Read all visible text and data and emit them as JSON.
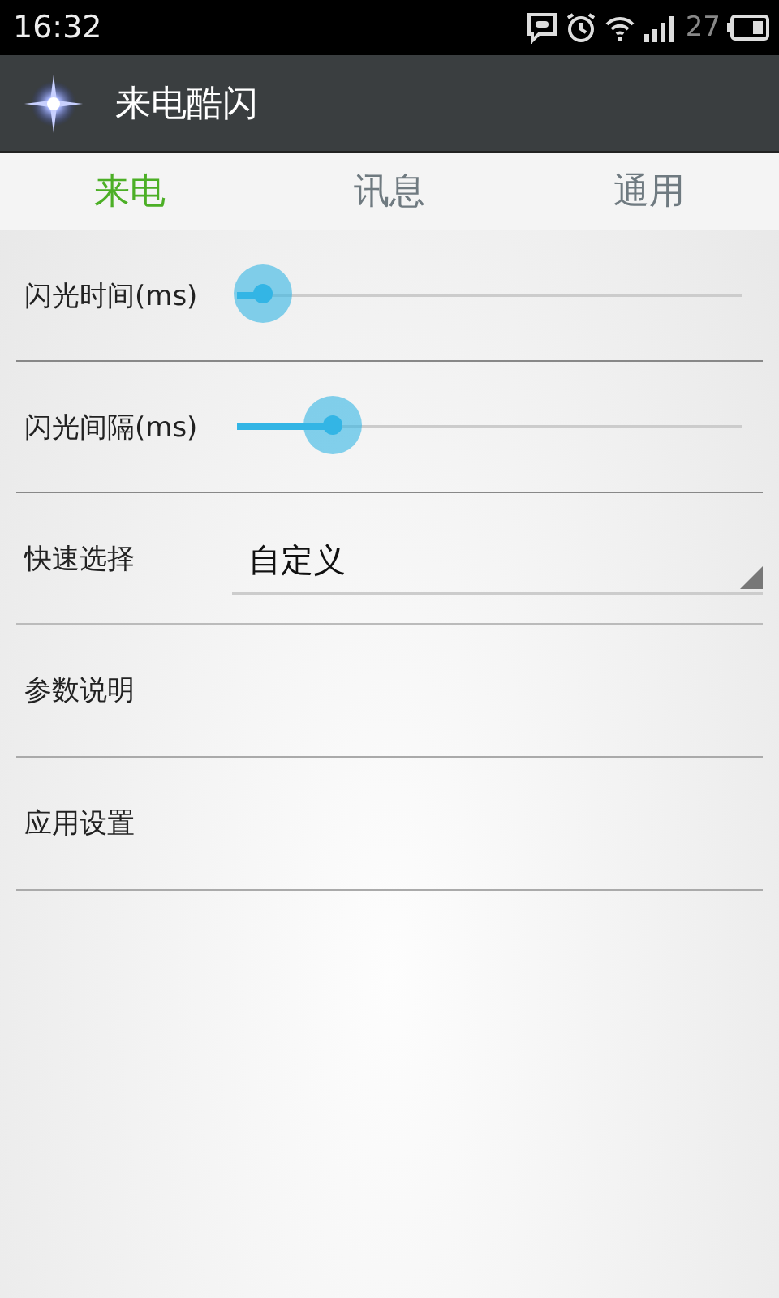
{
  "status_bar": {
    "time": "16:32",
    "battery_text": "27"
  },
  "app_bar": {
    "title": "来电酷闪"
  },
  "tabs": [
    {
      "label": "来电",
      "selected": true
    },
    {
      "label": "讯息",
      "selected": false
    },
    {
      "label": "通用",
      "selected": false
    }
  ],
  "settings": [
    {
      "kind": "slider",
      "label": "闪光时间(ms)",
      "level": 0.05
    },
    {
      "kind": "slider",
      "label": "闪光间隔(ms)",
      "level": 0.19
    },
    {
      "kind": "dropdown",
      "label": "快速选择",
      "value": "自定义"
    },
    {
      "kind": "item",
      "label": "参数说明"
    },
    {
      "kind": "item",
      "label": "应用设置"
    }
  ]
}
